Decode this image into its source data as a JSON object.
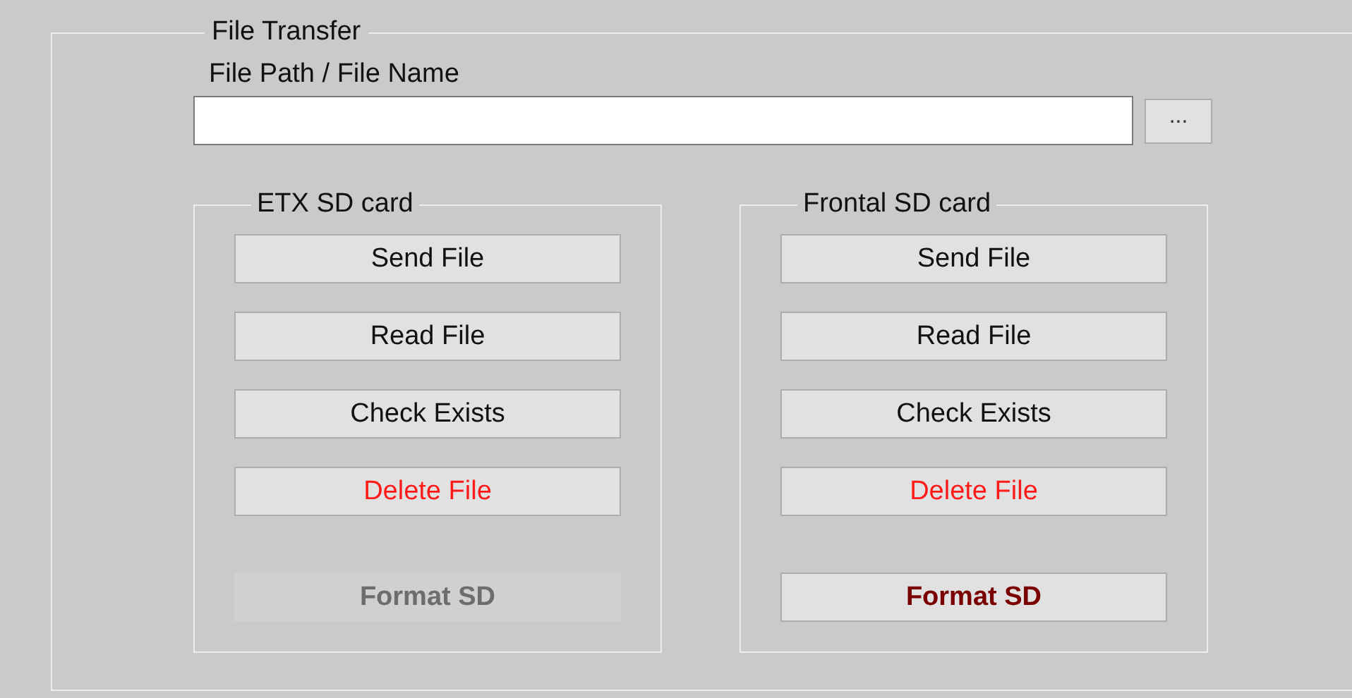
{
  "frame": {
    "title": "File Transfer"
  },
  "path_field": {
    "label": "File Path / File Name",
    "browse_button": "..."
  },
  "groups": [
    {
      "title": "ETX SD card",
      "buttons": [
        {
          "label": "Send File",
          "kind": "normal",
          "disabled": false
        },
        {
          "label": "Read File",
          "kind": "normal",
          "disabled": false
        },
        {
          "label": "Check Exists",
          "kind": "normal",
          "disabled": false
        },
        {
          "label": "Delete File",
          "kind": "danger",
          "disabled": false
        },
        {
          "label": "Format SD",
          "kind": "format",
          "disabled": true
        }
      ]
    },
    {
      "title": "Frontal SD card",
      "buttons": [
        {
          "label": "Send File",
          "kind": "normal",
          "disabled": false
        },
        {
          "label": "Read File",
          "kind": "normal",
          "disabled": false
        },
        {
          "label": "Check Exists",
          "kind": "normal",
          "disabled": false
        },
        {
          "label": "Delete File",
          "kind": "danger",
          "disabled": false
        },
        {
          "label": "Format SD",
          "kind": "format",
          "disabled": false
        }
      ]
    }
  ]
}
